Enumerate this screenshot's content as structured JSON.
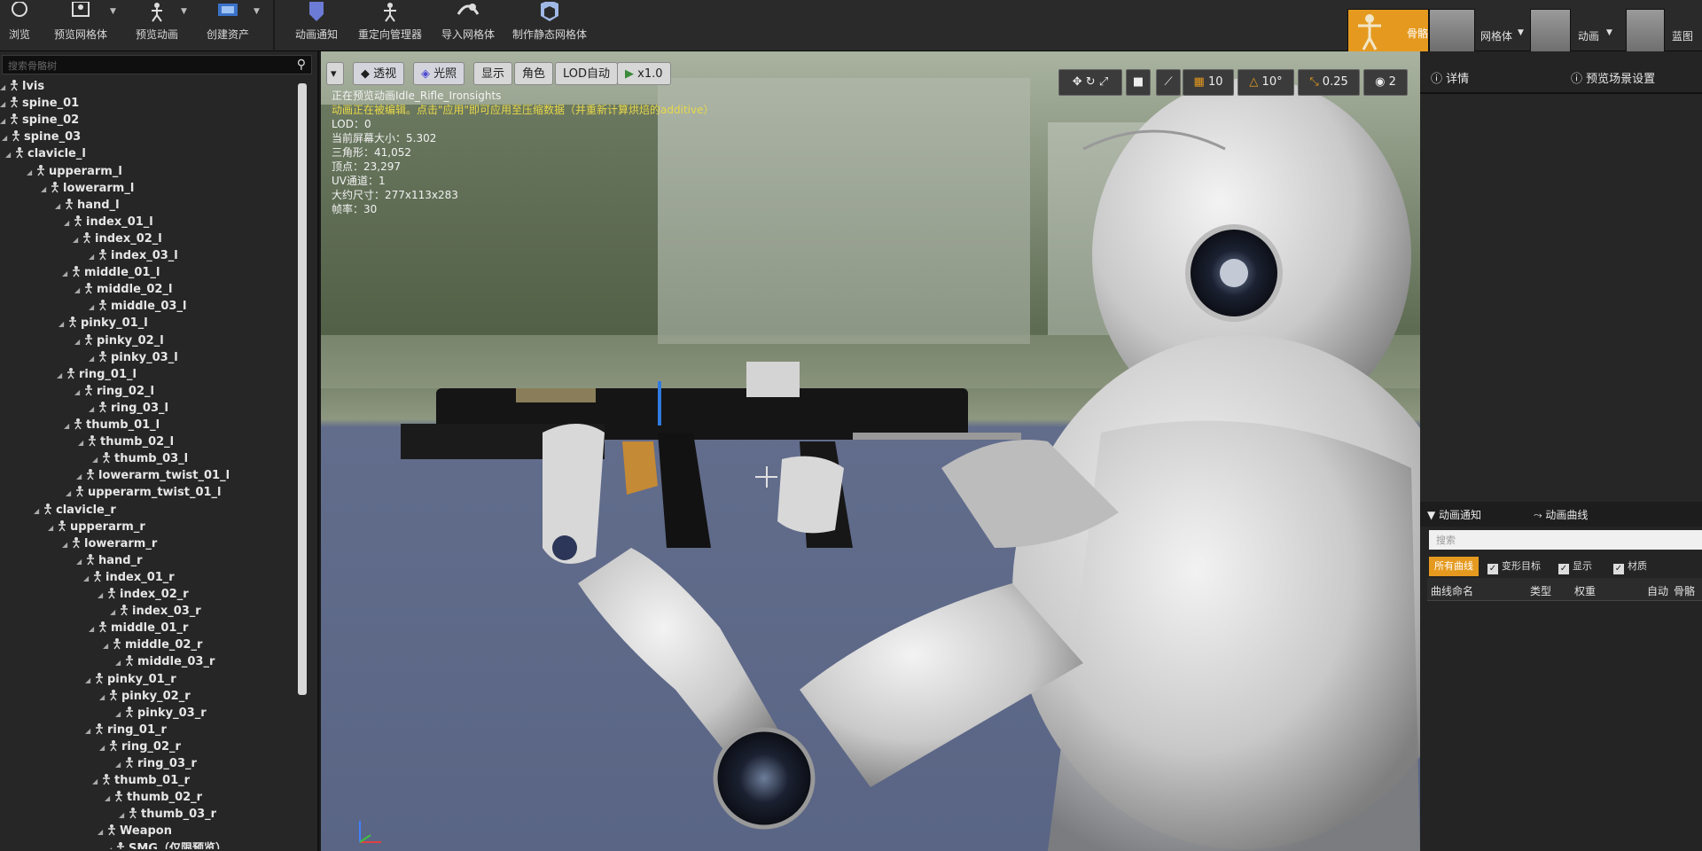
{
  "toolbar": {
    "buttons": [
      {
        "label": "浏览",
        "icon": "browse-icon"
      },
      {
        "label": "预览网格体",
        "icon": "preview-mesh-icon"
      },
      {
        "label": "预览动画",
        "icon": "preview-animation-icon"
      },
      {
        "label": "创建资产",
        "icon": "create-asset-icon"
      },
      {
        "label": "动画通知",
        "icon": "anim-notify-icon"
      },
      {
        "label": "重定向管理器",
        "icon": "retarget-manager-icon"
      },
      {
        "label": "导入网格体",
        "icon": "import-mesh-icon"
      },
      {
        "label": "制作静态网格体",
        "icon": "make-static-mesh-icon"
      }
    ],
    "modes": [
      {
        "label": "骨骼",
        "active": true
      },
      {
        "label": "网格体",
        "active": false
      },
      {
        "label": "动画",
        "active": false
      },
      {
        "label": "蓝图",
        "active": false
      }
    ]
  },
  "skeleton_tree": {
    "search_placeholder": "搜索骨骼树",
    "bones": [
      {
        "name": "lvis"
      },
      {
        "name": "spine_01"
      },
      {
        "name": "spine_02"
      },
      {
        "name": "spine_03"
      },
      {
        "name": "clavicle_l"
      },
      {
        "name": "upperarm_l"
      },
      {
        "name": "lowerarm_l"
      },
      {
        "name": "hand_l"
      },
      {
        "name": "index_01_l"
      },
      {
        "name": "index_02_l"
      },
      {
        "name": "index_03_l"
      },
      {
        "name": "middle_01_l"
      },
      {
        "name": "middle_02_l"
      },
      {
        "name": "middle_03_l"
      },
      {
        "name": "pinky_01_l"
      },
      {
        "name": "pinky_02_l"
      },
      {
        "name": "pinky_03_l"
      },
      {
        "name": "ring_01_l"
      },
      {
        "name": "ring_02_l"
      },
      {
        "name": "ring_03_l"
      },
      {
        "name": "thumb_01_l"
      },
      {
        "name": "thumb_02_l"
      },
      {
        "name": "thumb_03_l"
      },
      {
        "name": "lowerarm_twist_01_l"
      },
      {
        "name": "upperarm_twist_01_l"
      },
      {
        "name": "clavicle_r"
      },
      {
        "name": "upperarm_r"
      },
      {
        "name": "lowerarm_r"
      },
      {
        "name": "hand_r"
      },
      {
        "name": "index_01_r"
      },
      {
        "name": "index_02_r"
      },
      {
        "name": "index_03_r"
      },
      {
        "name": "middle_01_r"
      },
      {
        "name": "middle_02_r"
      },
      {
        "name": "middle_03_r"
      },
      {
        "name": "pinky_01_r"
      },
      {
        "name": "pinky_02_r"
      },
      {
        "name": "pinky_03_r"
      },
      {
        "name": "ring_01_r"
      },
      {
        "name": "ring_02_r"
      },
      {
        "name": "ring_03_r"
      },
      {
        "name": "thumb_01_r"
      },
      {
        "name": "thumb_02_r"
      },
      {
        "name": "thumb_03_r"
      },
      {
        "name": "Weapon"
      },
      {
        "name": "SMG（仅限预览）"
      }
    ]
  },
  "viewport": {
    "buttons": {
      "perspective": "透视",
      "lit": "光照",
      "show": "显示",
      "character": "角色",
      "lod": "LOD自动",
      "speed": "x1.0"
    },
    "snap": {
      "grid": "10",
      "rotation": "10°",
      "scale": "0.25",
      "camera_speed": "2"
    },
    "stats": {
      "line1": "正在预览动画Idle_Rifle_Ironsights",
      "line2": "动画正在被编辑。点击\"应用\"即可应用至压缩数据（并重新计算烘焙的additive）",
      "lod": "LOD：0",
      "screen_size": "当前屏幕大小：5.302",
      "triangles": "三角形：41,052",
      "vertices": "顶点：23,297",
      "uv": "UV通道：1",
      "bounds": "大约尺寸：277x113x283",
      "fps": "帧率：30"
    }
  },
  "right_panel": {
    "tab_details": "详情",
    "tab_preview_scene": "预览场景设置",
    "tab_anim_notify": "动画通知",
    "tab_anim_curves": "动画曲线",
    "search_placeholder": "搜索",
    "filters": {
      "all_curves": "所有曲线",
      "morph_target": "变形目标",
      "display": "显示",
      "material": "材质"
    },
    "columns": {
      "curve_name": "曲线命名",
      "type": "类型",
      "weight": "权重",
      "auto": "自动",
      "bone": "骨骼"
    }
  },
  "colors": {
    "accent": "#e59a1f",
    "panel": "#262626",
    "toolbar": "#2a2a2a"
  }
}
